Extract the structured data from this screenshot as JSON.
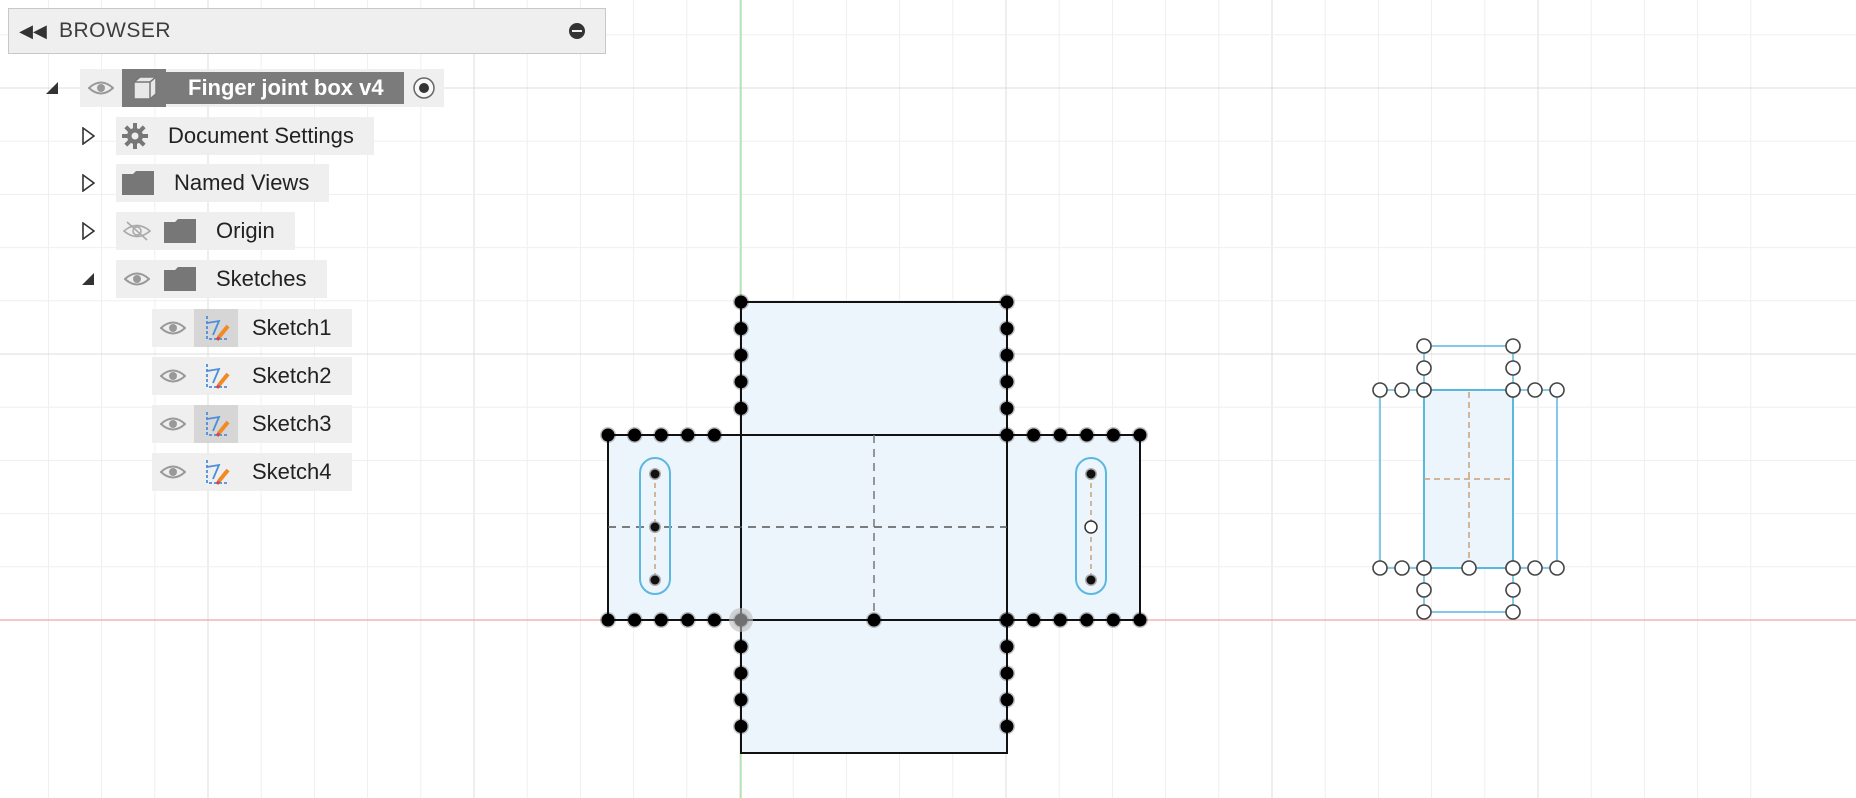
{
  "browser": {
    "title": "BROWSER",
    "root": {
      "label": "Finger joint box v4"
    },
    "items": [
      {
        "label": "Document Settings",
        "icon": "gear-icon"
      },
      {
        "label": "Named Views",
        "icon": "folder-icon"
      },
      {
        "label": "Origin",
        "icon": "folder-icon",
        "visibility": "hidden"
      },
      {
        "label": "Sketches",
        "icon": "folder-icon",
        "expanded": true
      }
    ],
    "sketches": [
      {
        "label": "Sketch1"
      },
      {
        "label": "Sketch2"
      },
      {
        "label": "Sketch3"
      },
      {
        "label": "Sketch4"
      }
    ]
  },
  "colors": {
    "x_axis": "#f08a8a",
    "y_axis": "#8fd98f",
    "grid": "#e9e9e9",
    "sketch_fill": "#edf5fc",
    "selection_blue": "#5bb8e0"
  }
}
